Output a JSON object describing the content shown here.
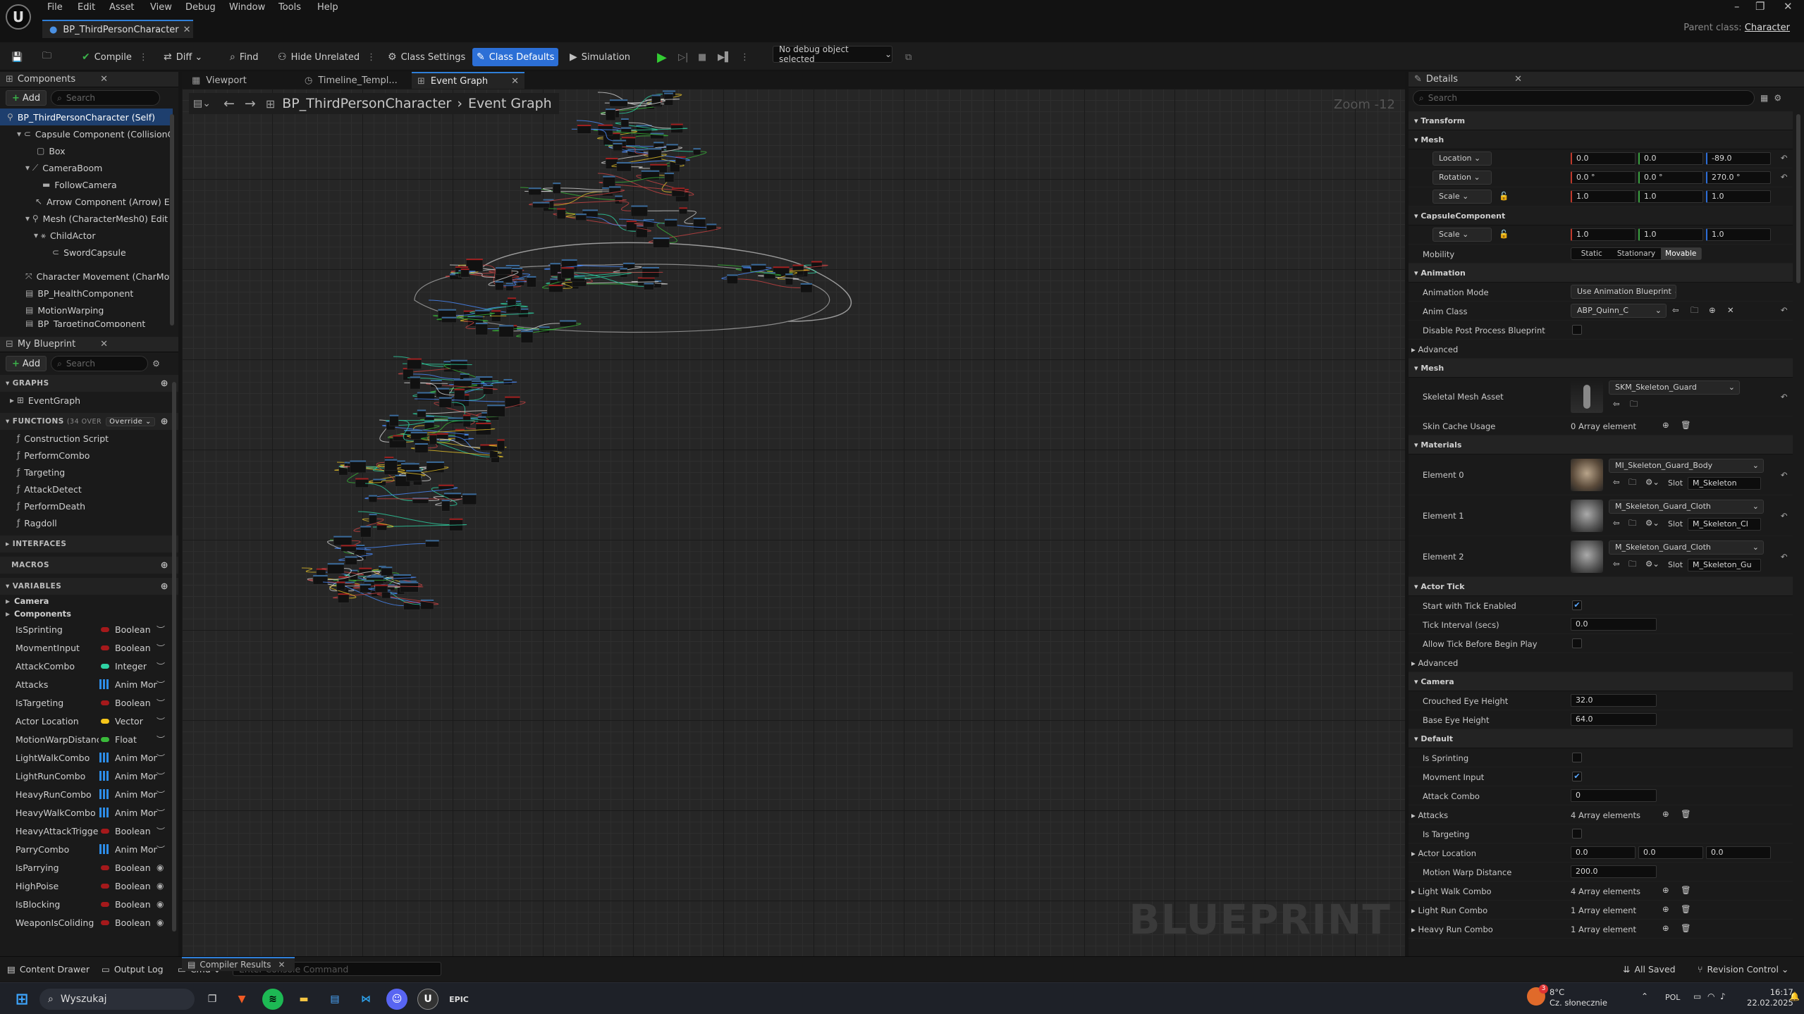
{
  "app": {
    "menu": [
      "File",
      "Edit",
      "Asset",
      "View",
      "Debug",
      "Window",
      "Tools",
      "Help"
    ],
    "doc_tab": "BP_ThirdPersonCharacter",
    "parent_class_label": "Parent class:",
    "parent_class_value": "Character"
  },
  "toolbar": {
    "compile": "Compile",
    "diff": "Diff",
    "find": "Find",
    "hide_unrelated": "Hide Unrelated",
    "class_settings": "Class Settings",
    "class_defaults": "Class Defaults",
    "simulation": "Simulation",
    "debug_object": "No debug object selected"
  },
  "components_panel": {
    "title": "Components",
    "add": "Add",
    "search_placeholder": "Search",
    "tree": [
      "BP_ThirdPersonCharacter (Self)",
      "Capsule Component (CollisionCylinder)",
      "Box",
      "CameraBoom",
      "FollowCamera",
      "Arrow Component (Arrow)",
      "Mesh (CharacterMesh0)",
      "ChildActor",
      "SwordCapsule",
      "Character Movement (CharMoveComp)",
      "BP_HealthComponent",
      "MotionWarping",
      "BP_TargetingComponent"
    ],
    "edit_inline_1": "Ed",
    "edit_inline_2": "Edit"
  },
  "blueprint_panel": {
    "title": "My Blueprint",
    "add": "Add",
    "search_placeholder": "Search",
    "graphs_hdr": "GRAPHS",
    "graphs": [
      "EventGraph"
    ],
    "functions_hdr": "FUNCTIONS",
    "functions_count": "(34 OVER",
    "override": "Override",
    "functions": [
      "Construction Script",
      "PerformCombo",
      "Targeting",
      "AttackDetect",
      "PerformDeath",
      "Ragdoll"
    ],
    "interfaces_hdr": "INTERFACES",
    "macros_hdr": "MACROS",
    "variables_hdr": "VARIABLES",
    "categories": [
      "Camera",
      "Components"
    ],
    "variables": [
      {
        "name": "IsSprinting",
        "type": "Boolean",
        "color": "#a5191b"
      },
      {
        "name": "MovmentInput",
        "type": "Boolean",
        "color": "#a5191b"
      },
      {
        "name": "AttackCombo",
        "type": "Integer",
        "color": "#2ed3a4"
      },
      {
        "name": "Attacks",
        "type": "Anim Mon",
        "color": "#2d8de8",
        "grid": true
      },
      {
        "name": "IsTargeting",
        "type": "Boolean",
        "color": "#a5191b"
      },
      {
        "name": "Actor Location",
        "type": "Vector",
        "color": "#f5c51a"
      },
      {
        "name": "MotionWarpDistance",
        "type": "Float",
        "color": "#3aba3a"
      },
      {
        "name": "LightWalkCombo",
        "type": "Anim Mon",
        "color": "#2d8de8",
        "grid": true
      },
      {
        "name": "LightRunCombo",
        "type": "Anim Mon",
        "color": "#2d8de8",
        "grid": true
      },
      {
        "name": "HeavyRunCombo",
        "type": "Anim Mon",
        "color": "#2d8de8",
        "grid": true
      },
      {
        "name": "HeavyWalkCombo",
        "type": "Anim Mon",
        "color": "#2d8de8",
        "grid": true
      },
      {
        "name": "HeavyAttackTrigger",
        "type": "Boolean",
        "color": "#a5191b"
      },
      {
        "name": "ParryCombo",
        "type": "Anim Mon",
        "color": "#2d8de8",
        "grid": true
      },
      {
        "name": "IsParrying",
        "type": "Boolean",
        "color": "#a5191b",
        "eye": true
      },
      {
        "name": "HighPoise",
        "type": "Boolean",
        "color": "#a5191b",
        "eye": true
      },
      {
        "name": "IsBlocking",
        "type": "Boolean",
        "color": "#a5191b",
        "eye": true
      },
      {
        "name": "WeaponIsColiding",
        "type": "Boolean",
        "color": "#a5191b",
        "eye": true
      }
    ]
  },
  "graph": {
    "tabs": [
      "Viewport",
      "Timeline_Templ...",
      "Event Graph"
    ],
    "breadcrumb_root": "BP_ThirdPersonCharacter",
    "breadcrumb_leaf": "Event Graph",
    "zoom": "Zoom -12",
    "watermark": "BLUEPRINT"
  },
  "details": {
    "title": "Details",
    "search_placeholder": "Search",
    "transform_hdr": "Transform",
    "mesh_hdr": "Mesh",
    "location": "Location",
    "rotation": "Rotation",
    "scale": "Scale",
    "loc": [
      "0.0",
      "0.0",
      "-89.0"
    ],
    "rot": [
      "0.0 °",
      "0.0 °",
      "270.0 °"
    ],
    "scl": [
      "1.0",
      "1.0",
      "1.0"
    ],
    "capsule_hdr": "CapsuleComponent",
    "cap_scale": [
      "1.0",
      "1.0",
      "1.0"
    ],
    "mobility": "Mobility",
    "mobility_opts": [
      "Static",
      "Stationary",
      "Movable"
    ],
    "animation_hdr": "Animation",
    "anim_mode_lbl": "Animation Mode",
    "anim_mode": "Use Animation Blueprint",
    "anim_class_lbl": "Anim Class",
    "anim_class": "ABP_Quinn_C",
    "disable_pp": "Disable Post Process Blueprint",
    "advanced": "Advanced",
    "mesh2_hdr": "Mesh",
    "skel_mesh_lbl": "Skeletal Mesh Asset",
    "skel_mesh": "SKM_Skeleton_Guard",
    "skin_cache": "Skin Cache Usage",
    "skin_cache_val": "0 Array element",
    "materials_hdr": "Materials",
    "slot_lbl": "Slot",
    "elements": [
      {
        "label": "Element 0",
        "mat": "MI_Skeleton_Guard_Body",
        "slot": "M_Skeleton"
      },
      {
        "label": "Element 1",
        "mat": "M_Skeleton_Guard_Cloth",
        "slot": "M_Skeleton_Cl"
      },
      {
        "label": "Element 2",
        "mat": "M_Skeleton_Guard_Cloth",
        "slot": "M_Skeleton_Gu"
      }
    ],
    "actor_tick_hdr": "Actor Tick",
    "start_tick": "Start with Tick Enabled",
    "tick_interval": "Tick Interval (secs)",
    "tick_interval_val": "0.0",
    "allow_tick": "Allow Tick Before Begin Play",
    "camera_hdr": "Camera",
    "crouched_eye": "Crouched Eye Height",
    "crouched_eye_val": "32.0",
    "base_eye": "Base Eye Height",
    "base_eye_val": "64.0",
    "default_hdr": "Default",
    "is_sprinting": "Is Sprinting",
    "movment_input": "Movment Input",
    "attack_combo": "Attack Combo",
    "attack_combo_val": "0",
    "attacks": "Attacks",
    "attacks_val": "4 Array elements",
    "is_targeting": "Is Targeting",
    "actor_location": "Actor Location",
    "actor_loc": [
      "0.0",
      "0.0",
      "0.0"
    ],
    "motion_warp": "Motion Warp Distance",
    "motion_warp_val": "200.0",
    "light_walk": "Light Walk Combo",
    "light_walk_val": "4 Array elements",
    "light_run": "Light Run Combo",
    "light_run_val": "1 Array element",
    "heavy_run": "Heavy Run Combo",
    "heavy_run_val": "1 Array element"
  },
  "statusbar": {
    "content_drawer": "Content Drawer",
    "output_log": "Output Log",
    "cmd": "Cmd",
    "console_placeholder": "Enter Console Command",
    "compiler_results": "Compiler Results",
    "all_saved": "All Saved",
    "revision_control": "Revision Control"
  },
  "taskbar": {
    "search": "Wyszukaj",
    "temp": "8°C",
    "weather": "Cz. słonecznie",
    "lang": "POL",
    "time": "16:17",
    "date": "22.02.2025",
    "notif": "3"
  }
}
